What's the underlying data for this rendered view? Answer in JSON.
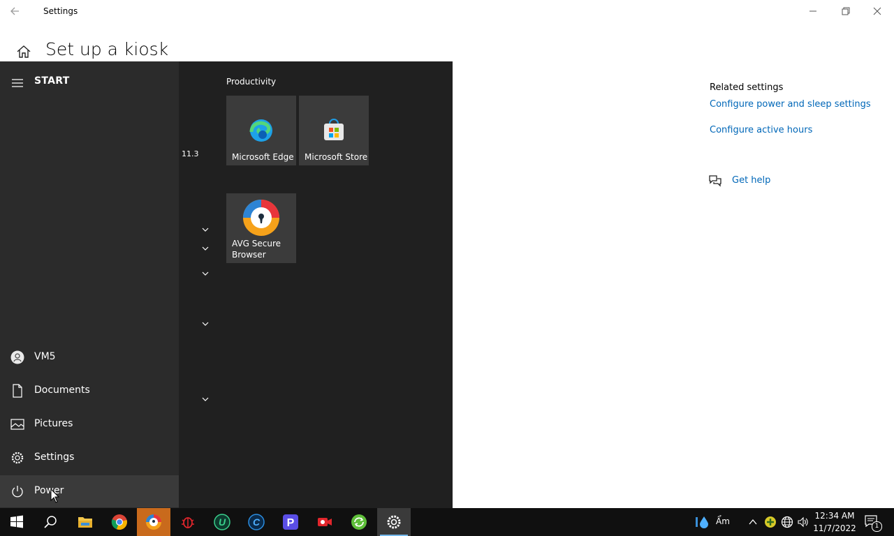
{
  "window": {
    "title": "Settings",
    "page_title": "Set up a kiosk"
  },
  "related": {
    "title": "Related settings",
    "links": [
      "Configure power and sleep settings",
      "Configure active hours"
    ],
    "get_help": "Get help"
  },
  "start": {
    "label": "START",
    "nav": {
      "user": "VM5",
      "documents": "Documents",
      "pictures": "Pictures",
      "settings": "Settings",
      "power": "Power"
    },
    "app_list_label": "11.3",
    "group_title": "Productivity",
    "tiles": {
      "edge": "Microsoft Edge",
      "store": "Microsoft Store",
      "avg": "AVG Secure Browser"
    }
  },
  "taskbar": {
    "tray_text": "Ẩm",
    "time": "12:34 AM",
    "date": "11/7/2022",
    "notification_count": "1"
  },
  "colors": {
    "link": "#0067b8",
    "start_bg": "#202020",
    "taskbar_bg": "#101010",
    "accent": "#76b9ed"
  }
}
